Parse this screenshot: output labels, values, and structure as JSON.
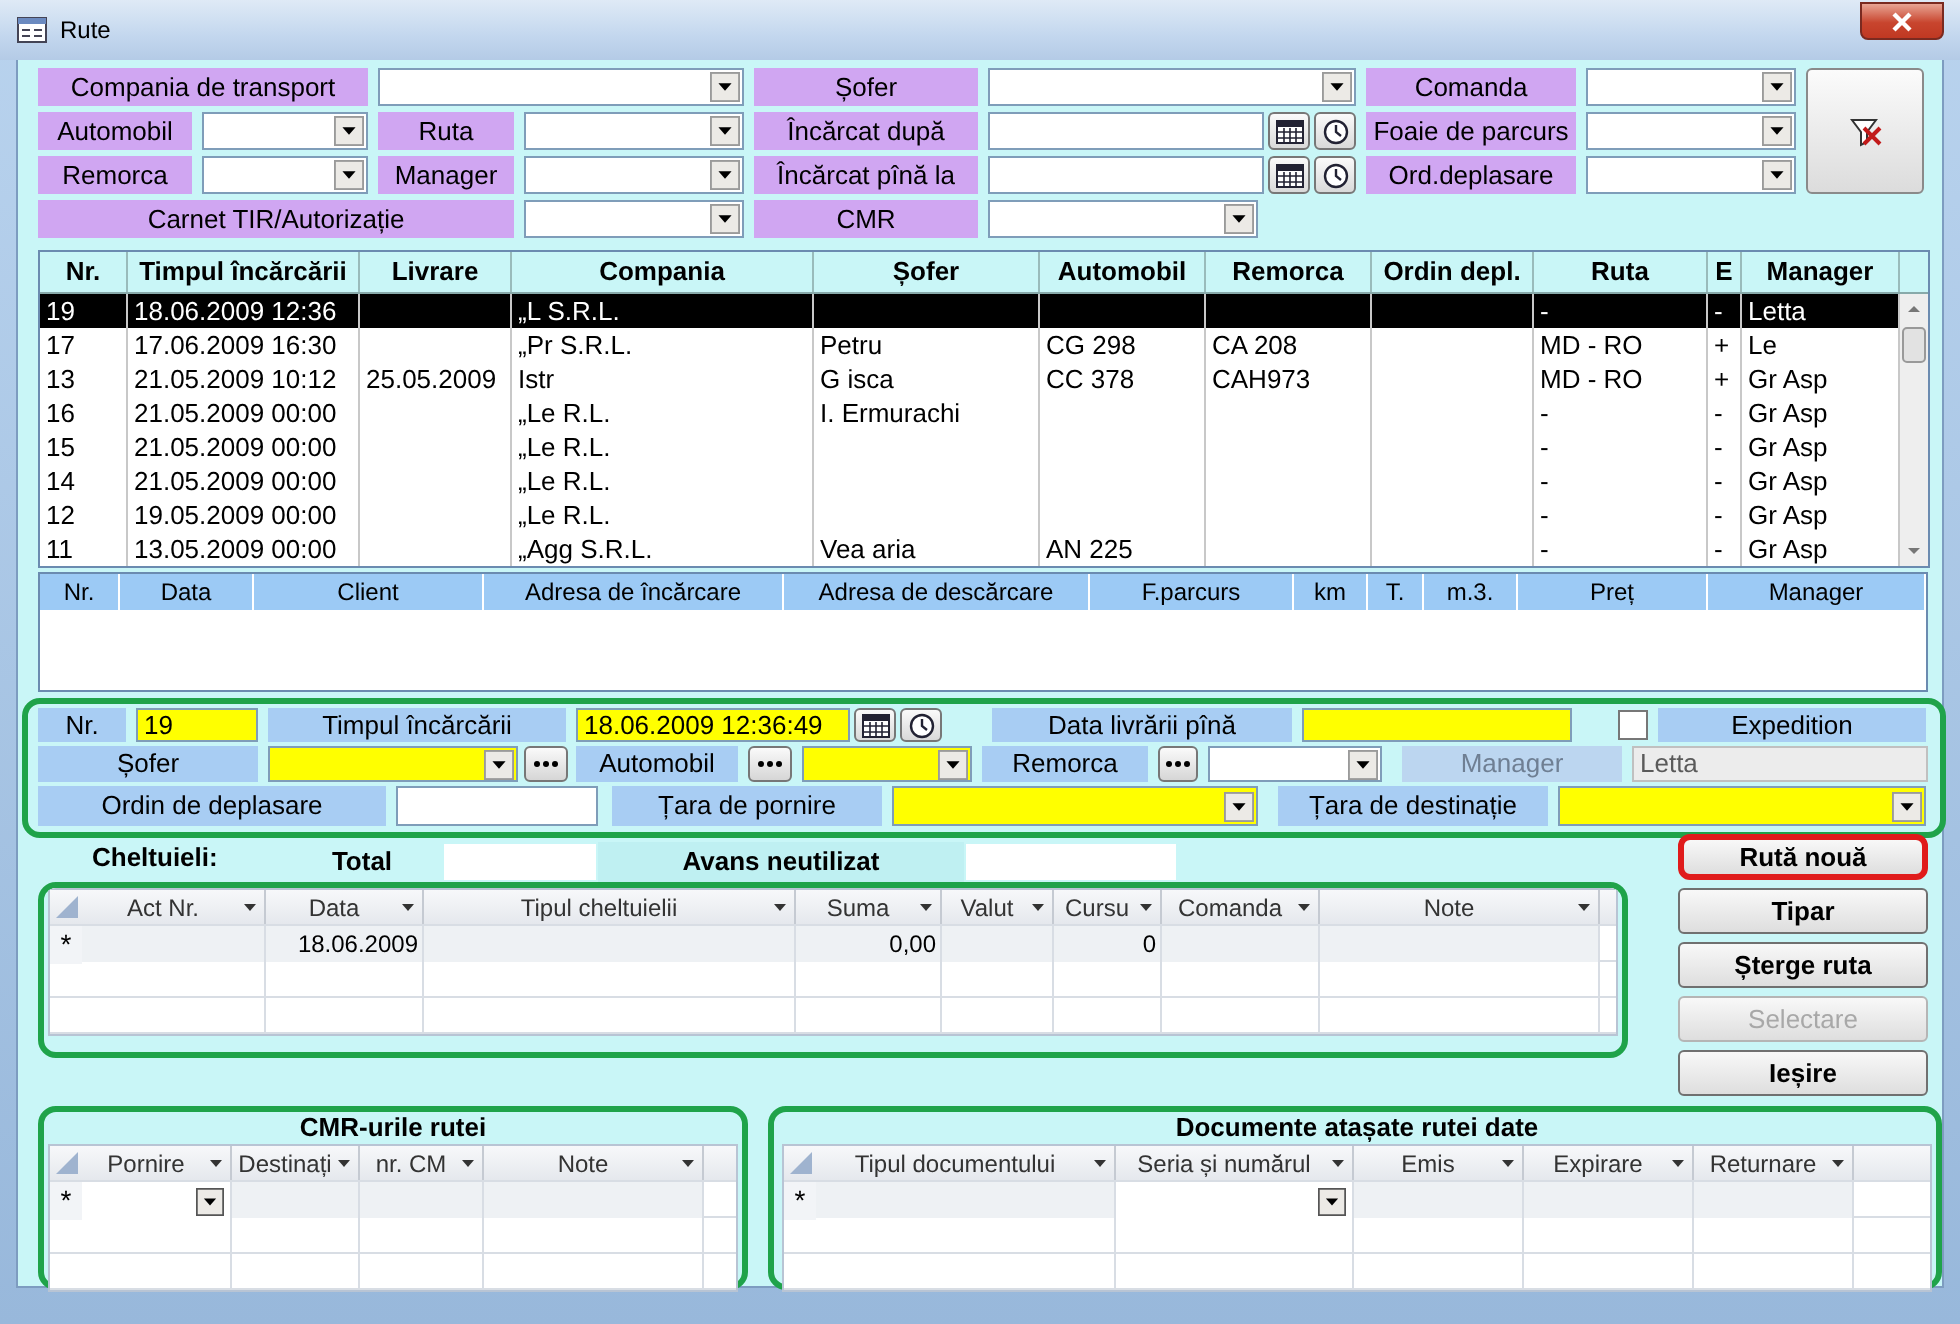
{
  "window": {
    "title": "Rute"
  },
  "filters": [
    {
      "label": "Compania de transport",
      "kind": "combo"
    },
    {
      "label": "Șofer",
      "kind": "combo"
    },
    {
      "label": "Comanda",
      "kind": "combo"
    },
    {
      "label": "Automobil",
      "kind": "combo"
    },
    {
      "label": "Ruta",
      "kind": "combo"
    },
    {
      "label": "Încărcat după",
      "kind": "date"
    },
    {
      "label": "Foaie de parcurs",
      "kind": "combo"
    },
    {
      "label": "Remorca",
      "kind": "combo"
    },
    {
      "label": "Manager",
      "kind": "combo"
    },
    {
      "label": "Încărcat pînă la",
      "kind": "date"
    },
    {
      "label": "Ord.deplasare",
      "kind": "combo"
    },
    {
      "label": "Carnet TIR/Autorizație",
      "kind": "combo"
    },
    {
      "label": "CMR",
      "kind": "combo"
    }
  ],
  "routes": {
    "columns": [
      "Nr.",
      "Timpul încărcării",
      "Livrare",
      "Compania",
      "Șofer",
      "Automobil",
      "Remorca",
      "Ordin depl.",
      "Ruta",
      "E",
      "Manager"
    ],
    "rows": [
      {
        "selected": true,
        "cells": [
          "19",
          "18.06.2009 12:36",
          "",
          "„L S.R.L.",
          "",
          "",
          "",
          "",
          "-",
          "-",
          "Letta"
        ]
      },
      {
        "selected": false,
        "cells": [
          "17",
          "17.06.2009 16:30",
          "",
          "„Pr S.R.L.",
          "Petru",
          "CG 298",
          "CA 208",
          "",
          "MD - RO",
          "+",
          "Le"
        ]
      },
      {
        "selected": false,
        "cells": [
          "13",
          "21.05.2009 10:12",
          "25.05.2009",
          "Istr",
          "G isca",
          "CC 378",
          "CAH973",
          "",
          "MD - RO",
          "+",
          "Gr Asp"
        ]
      },
      {
        "selected": false,
        "cells": [
          "16",
          "21.05.2009 00:00",
          "",
          "„Le R.L.",
          "I. Ermurachi",
          "",
          "",
          "",
          "-",
          "-",
          "Gr Asp"
        ]
      },
      {
        "selected": false,
        "cells": [
          "15",
          "21.05.2009 00:00",
          "",
          "„Le R.L.",
          "",
          "",
          "",
          "",
          "-",
          "-",
          "Gr Asp"
        ]
      },
      {
        "selected": false,
        "cells": [
          "14",
          "21.05.2009 00:00",
          "",
          "„Le R.L.",
          "",
          "",
          "",
          "",
          "-",
          "-",
          "Gr Asp"
        ]
      },
      {
        "selected": false,
        "cells": [
          "12",
          "19.05.2009 00:00",
          "",
          "„Le R.L.",
          "",
          "",
          "",
          "",
          "-",
          "-",
          "Gr Asp"
        ]
      },
      {
        "selected": false,
        "cells": [
          "11",
          "13.05.2009 00:00",
          "",
          "„Agg S.R.L.",
          "Vea aria",
          "AN 225",
          "",
          "",
          "-",
          "-",
          "Gr Asp"
        ]
      }
    ]
  },
  "loads": {
    "columns": [
      "Nr.",
      "Data",
      "Client",
      "Adresa de încărcare",
      "Adresa de descărcare",
      "F.parcurs",
      "km",
      "T.",
      "m.3.",
      "Preț",
      "Manager"
    ]
  },
  "form": {
    "highlighted": true,
    "lines": [
      [
        {
          "kind": "label",
          "text": "Nr."
        },
        {
          "kind": "text",
          "value": "19",
          "required": true
        },
        {
          "kind": "label",
          "text": "Timpul încărcării"
        },
        {
          "kind": "date",
          "value": "18.06.2009 12:36:49",
          "required": true
        },
        {
          "kind": "label",
          "text": "Data livrării pînă"
        },
        {
          "kind": "text",
          "required": true
        },
        {
          "kind": "checkbox",
          "checked": false
        },
        {
          "kind": "label",
          "text": "Expedition"
        }
      ],
      [
        {
          "kind": "label",
          "text": "Șofer"
        },
        {
          "kind": "combo",
          "required": true
        },
        {
          "kind": "more"
        },
        {
          "kind": "label",
          "text": "Automobil"
        },
        {
          "kind": "more"
        },
        {
          "kind": "combo",
          "required": true
        },
        {
          "kind": "label",
          "text": "Remorca"
        },
        {
          "kind": "more"
        },
        {
          "kind": "combo",
          "required": false
        },
        {
          "kind": "label",
          "text": "Manager",
          "disabled": true
        },
        {
          "kind": "text",
          "value": "Letta",
          "disabled": true
        }
      ],
      [
        {
          "kind": "label",
          "text": "Ordin de deplasare"
        },
        {
          "kind": "text",
          "required": false
        },
        {
          "kind": "label",
          "text": "Țara de pornire"
        },
        {
          "kind": "combo",
          "required": true
        },
        {
          "kind": "label",
          "text": "Țara de destinație"
        },
        {
          "kind": "combo",
          "required": true
        }
      ]
    ]
  },
  "expenses": {
    "title": "Cheltuieli:",
    "total_label": "Total",
    "advance_label": "Avans neutilizat",
    "highlighted": true,
    "marker": "*",
    "columns": [
      "Act Nr.",
      "Data",
      "Tipul cheltuielii",
      "Suma",
      "Valut",
      "Cursu",
      "Comanda",
      "Note"
    ],
    "new_row": [
      {
        "kind": "text"
      },
      {
        "kind": "text",
        "value": "18.06.2009"
      },
      {
        "kind": "text"
      },
      {
        "kind": "text",
        "value": "0,00"
      },
      {
        "kind": "text"
      },
      {
        "kind": "text",
        "value": "0"
      },
      {
        "kind": "text"
      },
      {
        "kind": "text"
      }
    ]
  },
  "buttons": [
    {
      "label": "Rută nouă",
      "disabled": false,
      "highlighted": true
    },
    {
      "label": "Tipar",
      "disabled": false,
      "highlighted": false
    },
    {
      "label": "Șterge ruta",
      "disabled": false,
      "highlighted": false
    },
    {
      "label": "Selectare",
      "disabled": true,
      "highlighted": false
    },
    {
      "label": "Ieșire",
      "disabled": false,
      "highlighted": false
    }
  ],
  "cmr": {
    "title": "CMR-urile rutei",
    "highlighted": true,
    "marker": "*",
    "columns": [
      "Pornire",
      "Destinați",
      "nr. CM",
      "Note"
    ],
    "new_row": [
      {
        "kind": "combo"
      },
      {
        "kind": "text"
      },
      {
        "kind": "text"
      },
      {
        "kind": "text"
      }
    ]
  },
  "documents": {
    "title": "Documente atașate rutei date",
    "highlighted": true,
    "marker": "*",
    "columns": [
      "Tipul documentului",
      "Seria și numărul",
      "Emis",
      "Expirare",
      "Returnare"
    ],
    "new_row": [
      {
        "kind": "text"
      },
      {
        "kind": "combo"
      },
      {
        "kind": "text"
      },
      {
        "kind": "text"
      },
      {
        "kind": "text"
      }
    ]
  }
}
